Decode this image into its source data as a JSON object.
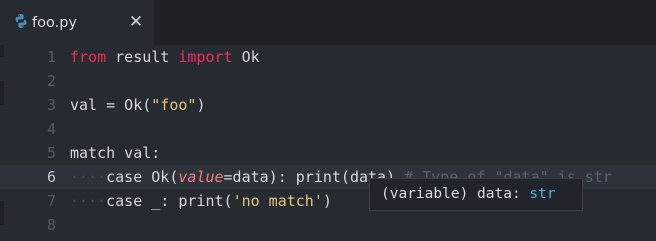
{
  "tab": {
    "label": "foo.py",
    "close_glyph": "✕",
    "icon": "python-icon"
  },
  "editor": {
    "current_line": 6,
    "lines": [
      {
        "number": "1",
        "segments": [
          {
            "t": "from",
            "c": "kw"
          },
          {
            "t": " result ",
            "c": "plain"
          },
          {
            "t": "import",
            "c": "kw"
          },
          {
            "t": " Ok",
            "c": "plain"
          }
        ]
      },
      {
        "number": "2",
        "segments": []
      },
      {
        "number": "3",
        "segments": [
          {
            "t": "val = Ok(",
            "c": "plain"
          },
          {
            "t": "\"foo\"",
            "c": "str"
          },
          {
            "t": ")",
            "c": "plain"
          }
        ]
      },
      {
        "number": "4",
        "segments": []
      },
      {
        "number": "5",
        "segments": [
          {
            "t": "match val:",
            "c": "plain"
          }
        ]
      },
      {
        "number": "6",
        "segments": [
          {
            "t": "····",
            "c": "dots"
          },
          {
            "t": "case Ok(",
            "c": "plain"
          },
          {
            "t": "value",
            "c": "param"
          },
          {
            "t": "=data): print(data) ",
            "c": "plain"
          },
          {
            "t": "# Type of \"data\" is str",
            "c": "comment"
          }
        ]
      },
      {
        "number": "7",
        "segments": [
          {
            "t": "····",
            "c": "dots"
          },
          {
            "t": "case _: print(",
            "c": "plain"
          },
          {
            "t": "'no match'",
            "c": "str"
          },
          {
            "t": ")",
            "c": "plain"
          }
        ]
      },
      {
        "number": "8",
        "segments": []
      }
    ]
  },
  "hover_tooltip": {
    "prefix": "(variable) data: ",
    "type": "str"
  },
  "colors": {
    "keyword": "#f02e5c",
    "string": "#e8c57b",
    "parameter": "#f47f7f",
    "comment": "#5b626c",
    "type": "#4db3df",
    "background": "#262a31"
  }
}
